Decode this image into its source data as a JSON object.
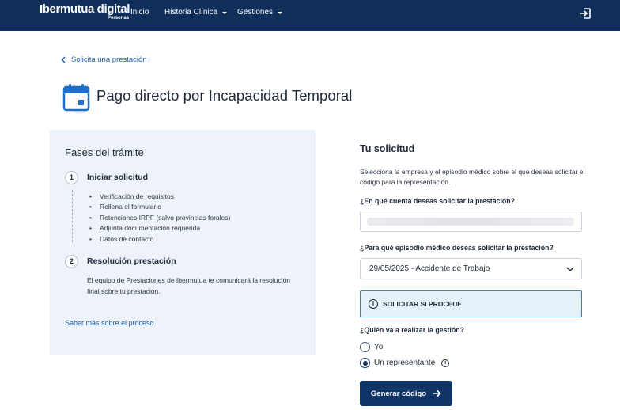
{
  "header": {
    "brand_name": "Ibermutua digital",
    "brand_sub": "Personas",
    "nav": [
      {
        "label": "Inicio"
      },
      {
        "label": "Historia Clínica"
      },
      {
        "label": "Gestiones"
      }
    ],
    "logout_icon": "logout-icon"
  },
  "back_link": "Solicita una prestación",
  "page_title": "Pago directo por Incapacidad Temporal",
  "phases": {
    "title": "Fases del trámite",
    "steps": [
      {
        "number": "1",
        "title": "Iniciar solicitud",
        "items": [
          "Verificación de requisitos",
          "Rellena el formulario",
          "Retenciones IRPF (salvo provincias forales)",
          "Adjunta documentación requerida",
          "Datos de contacto"
        ]
      },
      {
        "number": "2",
        "title": "Resolución prestación",
        "text": "El equipo de Prestaciones de Ibermutua te comunicará la resolución final sobre tu prestación."
      }
    ],
    "more_link": "Saber más sobre el proceso"
  },
  "form": {
    "title": "Tu solicitud",
    "intro": "Selecciona la empresa y el episodio médico sobre el que deseas solicitar el código para la representación.",
    "account_label": "¿En qué cuenta deseas solicitar la prestación?",
    "account_value": "",
    "episode_label": "¿Para qué episodio médico deseas solicitar la prestación?",
    "episode_value": "29/05/2025 - Accidente de Trabajo",
    "info_text": "SOLICITAR SI PROCEDE",
    "who_label": "¿Quién va a realizar la gestión?",
    "options": [
      {
        "label": "Yo",
        "selected": false
      },
      {
        "label": "Un representante",
        "selected": true
      }
    ],
    "submit_label": "Generar código"
  },
  "colors": {
    "header_bg": "#0f2f5a",
    "link": "#1d5fa8",
    "panel_bg": "#eef3f9",
    "info_bg": "#e6f2fa",
    "info_border": "#3d7dc4",
    "button_bg": "#0f3566"
  }
}
